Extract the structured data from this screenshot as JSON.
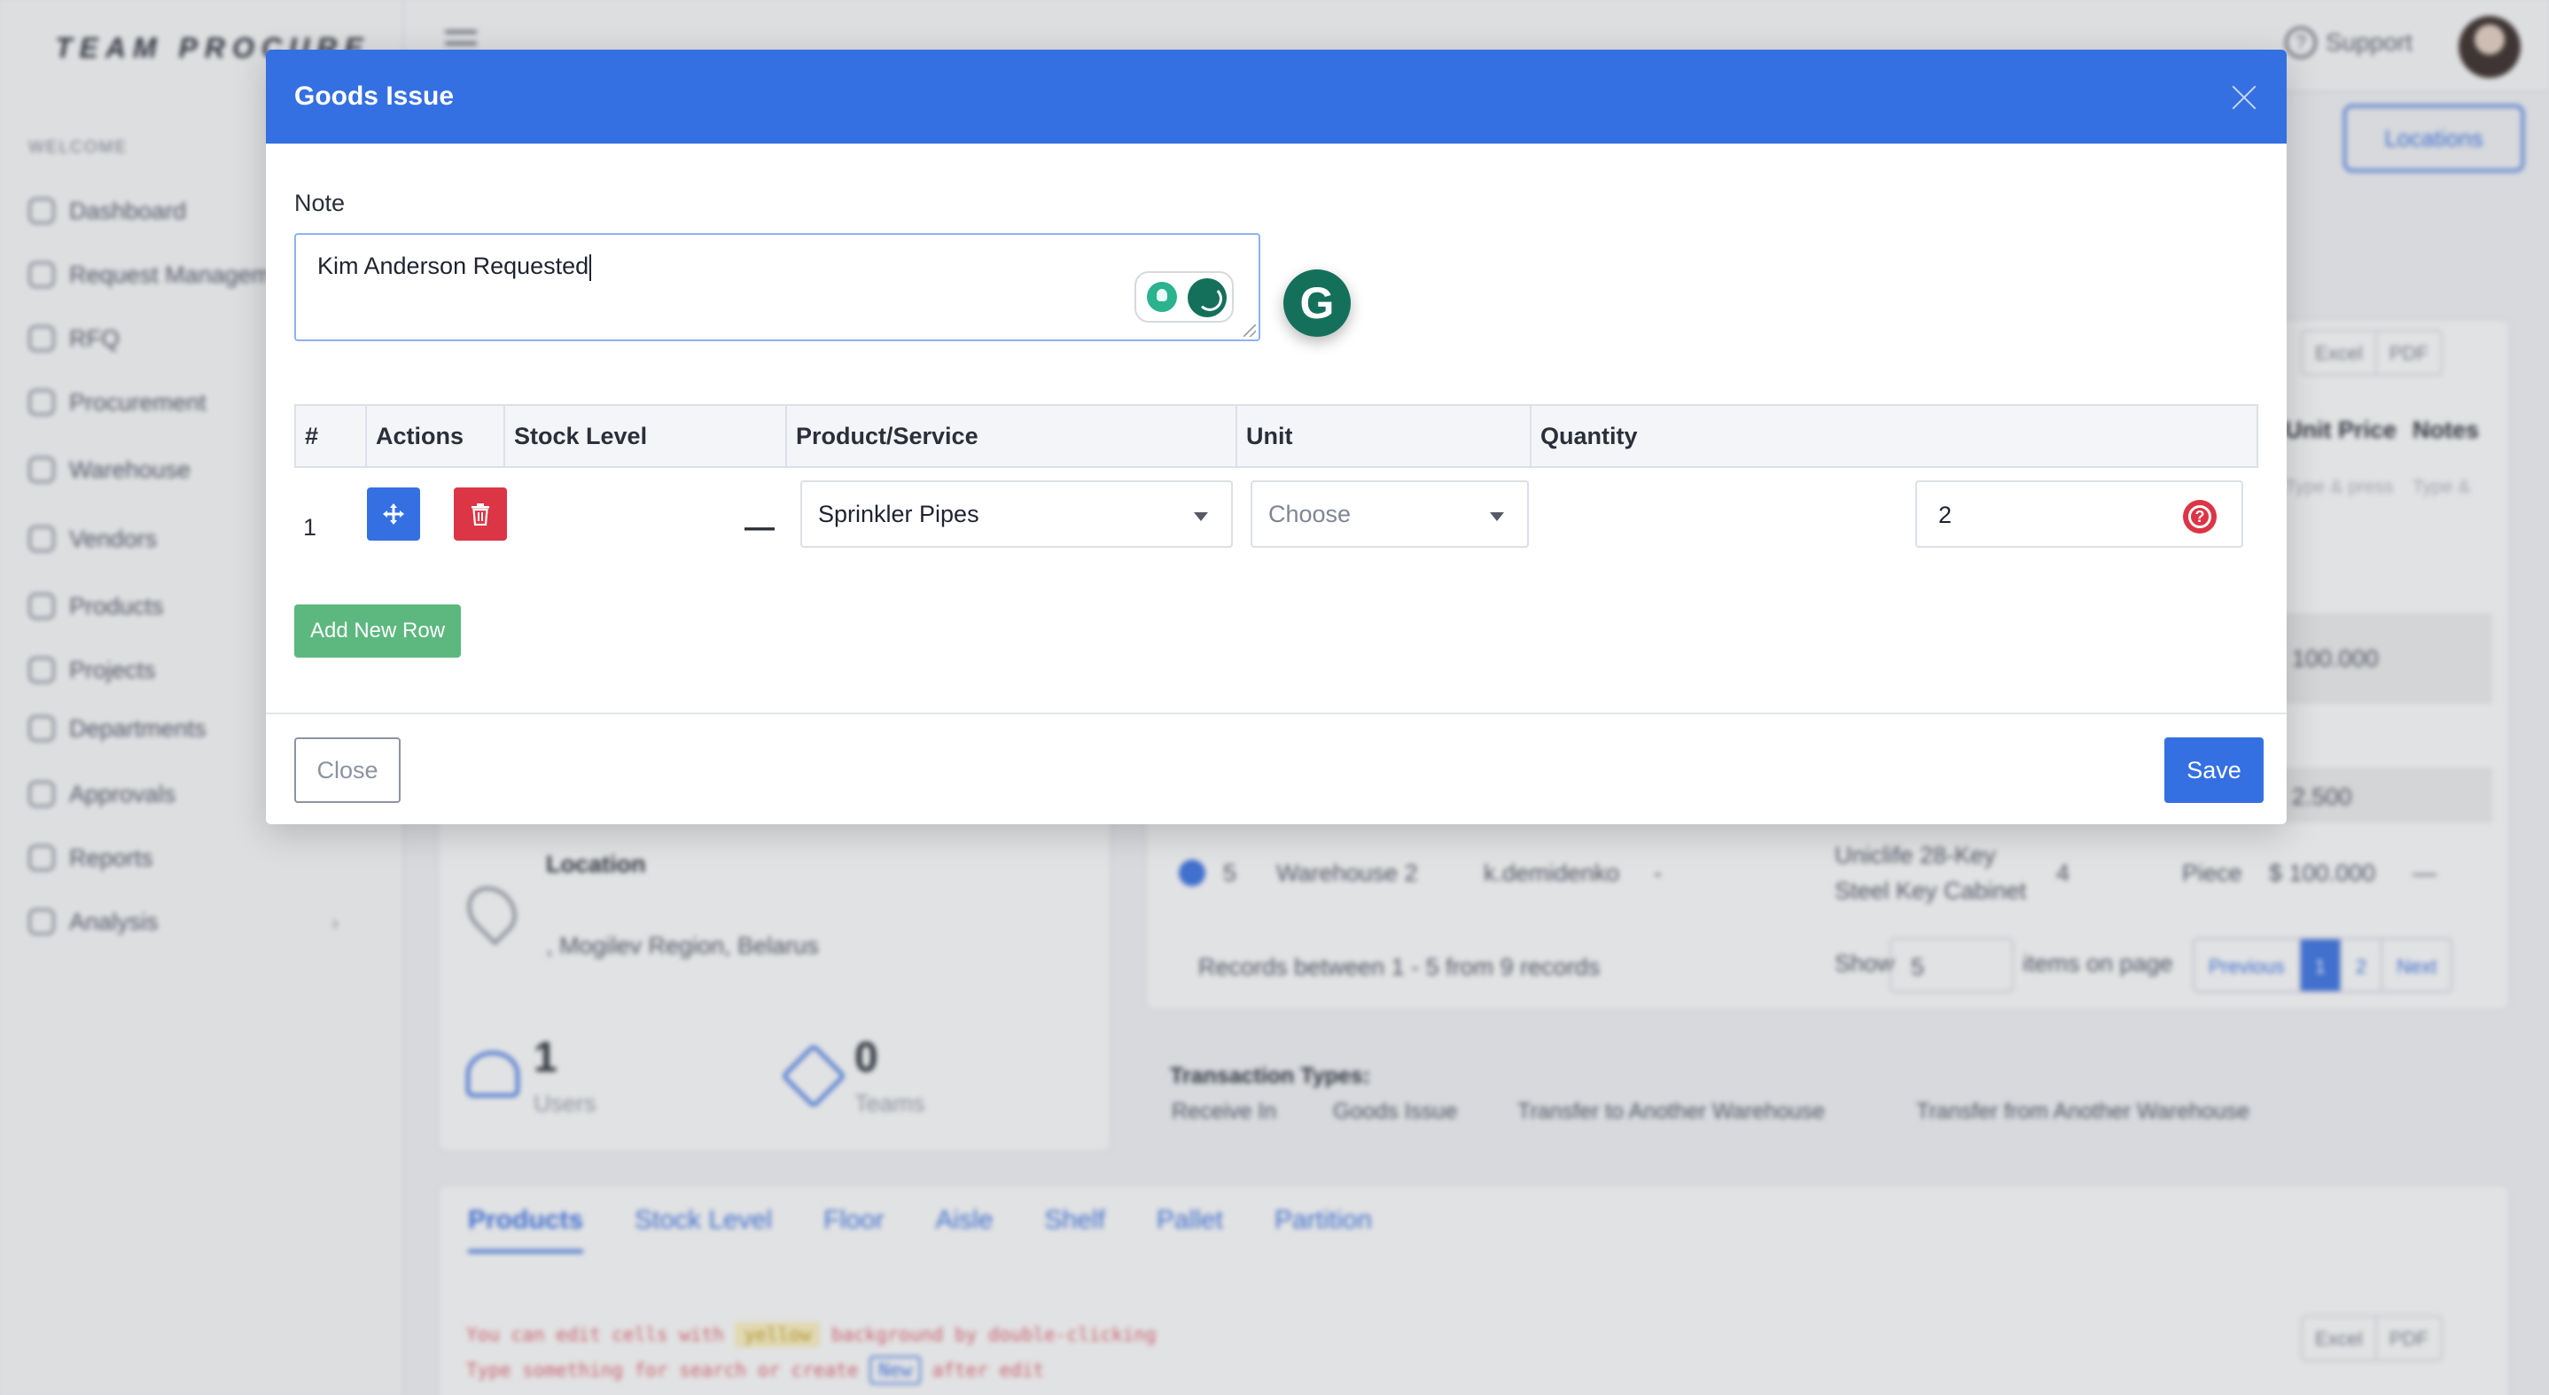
{
  "app": {
    "brand": "TEAM PROCURE",
    "support_label": "Support"
  },
  "sidebar": {
    "section_label": "WELCOME",
    "items": [
      {
        "label": "Dashboard",
        "icon": "home-icon"
      },
      {
        "label": "Request Management",
        "icon": "requests-icon"
      },
      {
        "label": "RFQ",
        "icon": "chart-icon"
      },
      {
        "label": "Procurement",
        "icon": "clipboard-icon"
      },
      {
        "label": "Warehouse",
        "icon": "globe-icon"
      },
      {
        "label": "Vendors",
        "icon": "document-icon"
      },
      {
        "label": "Products",
        "icon": "box-icon"
      },
      {
        "label": "Projects",
        "icon": "layers-icon"
      },
      {
        "label": "Departments",
        "icon": "hash-icon"
      },
      {
        "label": "Approvals",
        "icon": "x-icon"
      },
      {
        "label": "Reports",
        "icon": "chart-icon"
      },
      {
        "label": "Analysis",
        "icon": "clock-icon"
      }
    ]
  },
  "background": {
    "locations_button": "Locations",
    "excel_label": "Excel",
    "pdf_label": "PDF",
    "col_unit_price": "Unit Price",
    "col_notes": "Notes",
    "placeholder_type": "Type & press",
    "placeholder_type_short": "Type &",
    "price_1": "100.000",
    "price_2": "2.500",
    "location_title": "Location",
    "location_value": ", Mogilev Region, Belarus",
    "users_count": "1",
    "users_label": "Users",
    "teams_count": "0",
    "teams_label": "Teams",
    "row5": {
      "num": "5",
      "warehouse": "Warehouse 2",
      "user": "k.demidenko",
      "dash": "-",
      "product_line1": "Uniclife 28-Key",
      "product_line2": "Steel Key Cabinet",
      "qty": "4",
      "unit": "Piece",
      "price": "$ 100.000",
      "notes": "—"
    },
    "records_text": "Records between 1 - 5 from 9 records",
    "show_label": "Show",
    "show_value": "5",
    "items_on_page": "items on page",
    "pager": [
      "Previous",
      "1",
      "2",
      "Next"
    ],
    "transaction_types_title": "Transaction Types:",
    "transaction_types": [
      "Receive In",
      "Goods Issue",
      "Transfer to Another Warehouse",
      "Transfer from Another Warehouse"
    ],
    "tabs": [
      "Products",
      "Stock Level",
      "Floor",
      "Aisle",
      "Shelf",
      "Pallet",
      "Partition"
    ],
    "hint_1a": "You can edit cells with",
    "hint_1_badge": "yellow",
    "hint_1b": "background by double-clicking",
    "hint_2a": "Type something for search or create",
    "hint_2_badge": "New",
    "hint_2b": "after edit"
  },
  "modal": {
    "title": "Goods Issue",
    "note_label": "Note",
    "note_value": "Kim Anderson Requested",
    "grammarly_letter": "G",
    "table": {
      "headers": [
        "#",
        "Actions",
        "Stock Level",
        "Product/Service",
        "Unit",
        "Quantity"
      ],
      "rows": [
        {
          "num": "1",
          "stock_level": "—",
          "product": "Sprinkler Pipes",
          "unit_placeholder": "Choose",
          "quantity": "2"
        }
      ]
    },
    "add_row_label": "Add New Row",
    "close_label": "Close",
    "save_label": "Save"
  },
  "colors": {
    "header_blue": "#3570e3",
    "danger_red": "#dc3545",
    "success_green": "#5cb87e",
    "grammarly_green": "#15705b"
  }
}
